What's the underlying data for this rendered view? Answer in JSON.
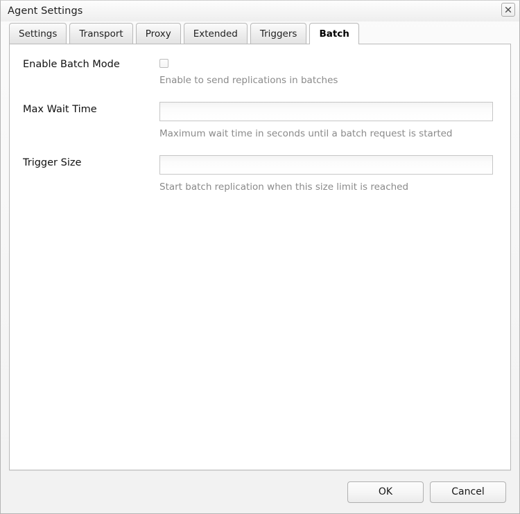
{
  "window": {
    "title": "Agent Settings",
    "close_icon": "close-icon"
  },
  "tabs": [
    {
      "label": "Settings",
      "active": false
    },
    {
      "label": "Transport",
      "active": false
    },
    {
      "label": "Proxy",
      "active": false
    },
    {
      "label": "Extended",
      "active": false
    },
    {
      "label": "Triggers",
      "active": false
    },
    {
      "label": "Batch",
      "active": true
    }
  ],
  "form": {
    "rows": [
      {
        "label": "Enable Batch Mode",
        "type": "checkbox",
        "checked": false,
        "help": "Enable to send replications in batches"
      },
      {
        "label": "Max Wait Time",
        "type": "text",
        "value": "",
        "placeholder": "",
        "help": "Maximum wait time in seconds until a batch request is started"
      },
      {
        "label": "Trigger Size",
        "type": "text",
        "value": "",
        "placeholder": "",
        "help": "Start batch replication when this size limit is reached"
      }
    ]
  },
  "footer": {
    "ok_label": "OK",
    "cancel_label": "Cancel"
  },
  "colors": {
    "window_background": "#f1f1f1",
    "panel_background": "#ffffff",
    "border": "#b9b9b9",
    "label_text": "#111111",
    "help_text": "#8a8a8a",
    "active_tab_background": "#ffffff"
  }
}
